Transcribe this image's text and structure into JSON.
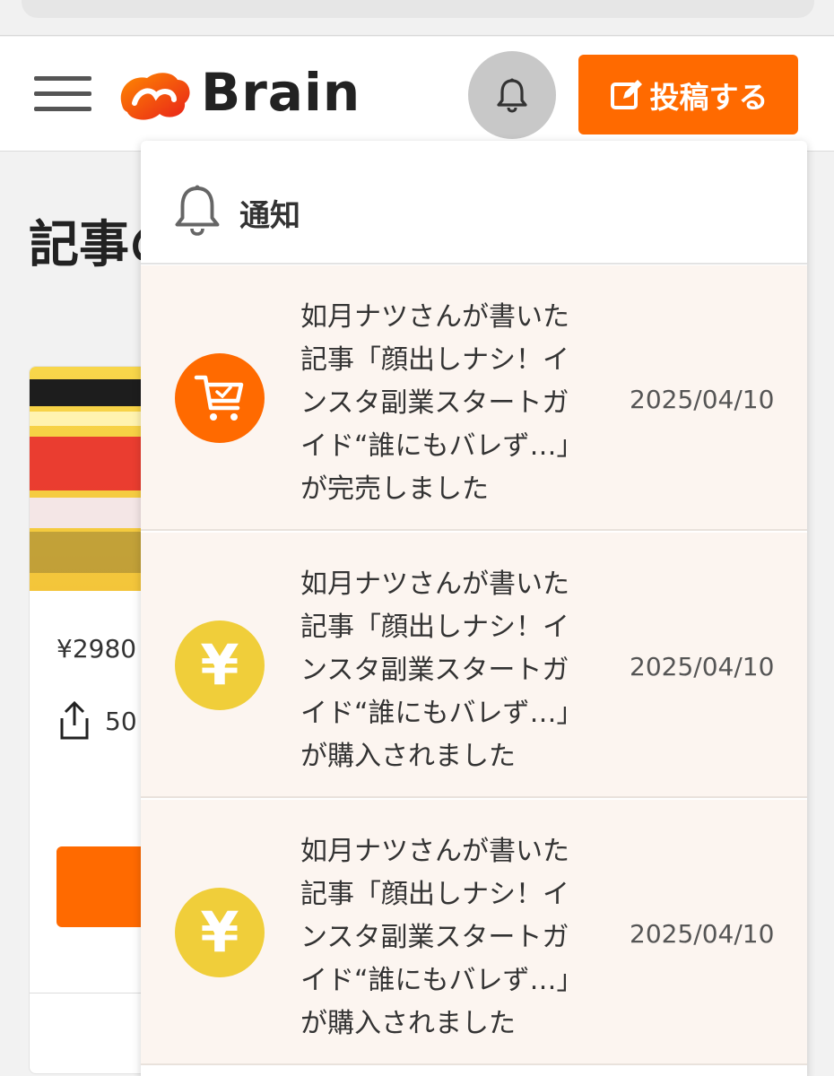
{
  "header": {
    "logo_text": "Brain",
    "post_button_label": "投稿する",
    "colors": {
      "accent": "#ff6a00",
      "bell_bg": "#c8c8c8"
    }
  },
  "page": {
    "title": "記事の",
    "card": {
      "price": "¥2980",
      "share_count": "50"
    }
  },
  "notifications": {
    "title": "通知",
    "items": [
      {
        "icon": "cart-icon",
        "line1": "如月ナツさんが書いた",
        "line2": "記事「顔出しナシ！イ",
        "line3": "ンスタ副業スタートガ",
        "line4": "イド“誰にもバレず…」",
        "line5": "が完売しました",
        "date": "2025/04/10"
      },
      {
        "icon": "yen-icon",
        "yen": "¥",
        "line1": "如月ナツさんが書いた",
        "line2": "記事「顔出しナシ！イ",
        "line3": "ンスタ副業スタートガ",
        "line4": "イド“誰にもバレず…」",
        "line5": "が購入されました",
        "date": "2025/04/10"
      },
      {
        "icon": "yen-icon",
        "yen": "¥",
        "line1": "如月ナツさんが書いた",
        "line2": "記事「顔出しナシ！イ",
        "line3": "ンスタ副業スタートガ",
        "line4": "イド“誰にもバレず…」",
        "line5": "が購入されました",
        "date": "2025/04/10"
      }
    ]
  }
}
